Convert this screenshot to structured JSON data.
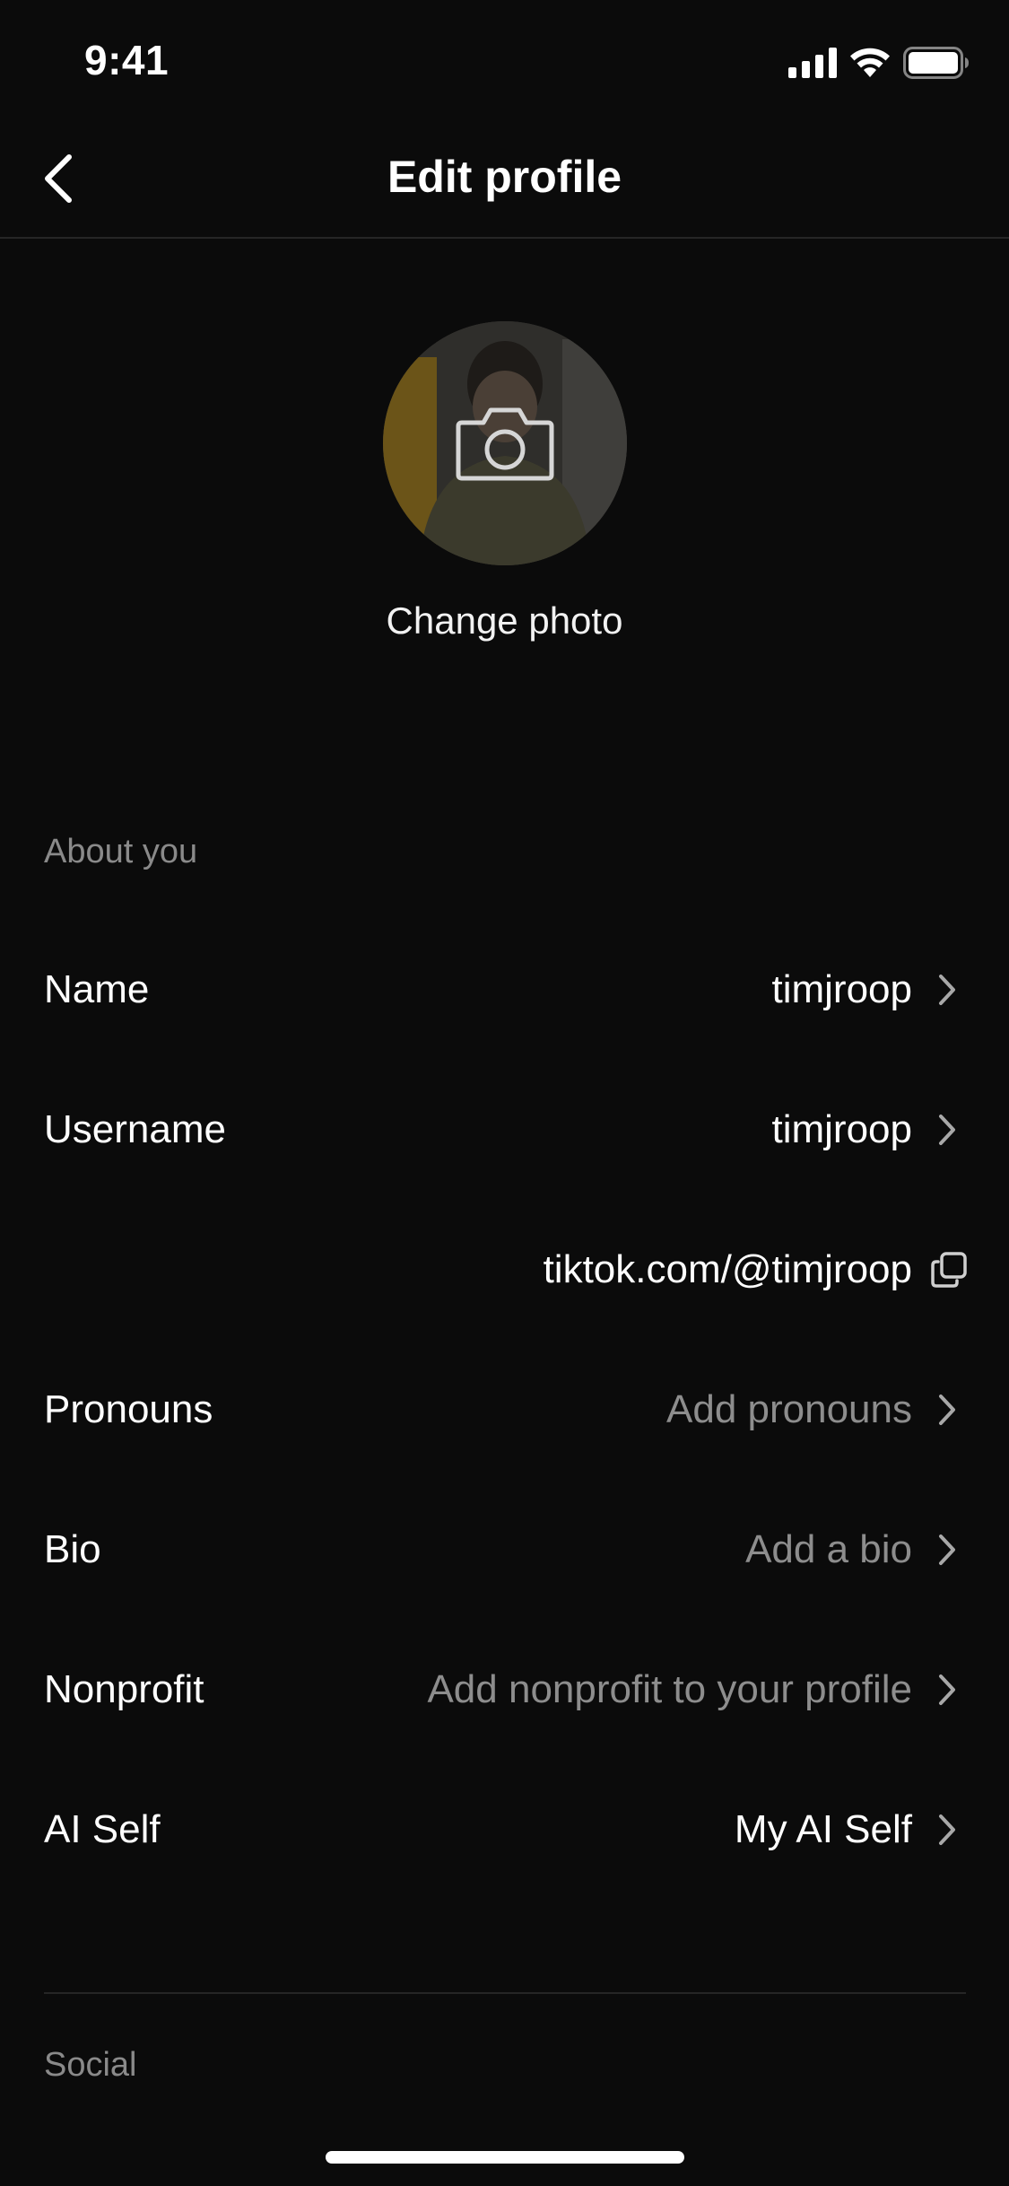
{
  "status_bar": {
    "time": "9:41"
  },
  "header": {
    "title": "Edit profile"
  },
  "profile_photo": {
    "change_label": "Change photo"
  },
  "about_section": {
    "label": "About you",
    "rows": [
      {
        "label": "Name",
        "value": "timjroop",
        "is_placeholder": false
      },
      {
        "label": "Username",
        "value": "timjroop",
        "is_placeholder": false
      },
      {
        "label": "",
        "value": "tiktok.com/@timjroop",
        "is_placeholder": false
      },
      {
        "label": "Pronouns",
        "value": "Add pronouns",
        "is_placeholder": true
      },
      {
        "label": "Bio",
        "value": "Add a bio",
        "is_placeholder": true
      },
      {
        "label": "Nonprofit",
        "value": "Add nonprofit to your profile",
        "is_placeholder": true
      },
      {
        "label": "AI Self",
        "value": "My AI Self",
        "is_placeholder": false
      }
    ]
  },
  "social_section": {
    "label": "Social"
  },
  "colors": {
    "background": "#0b0b0b",
    "text_primary": "#ffffff",
    "text_secondary": "#8a8a8a",
    "divider": "#262626"
  },
  "icons": {
    "back": "chevron-left-icon",
    "camera": "camera-icon",
    "row_chevron": "chevron-right-icon",
    "copy": "copy-icon",
    "signal": "cellular-signal-icon",
    "wifi": "wifi-icon",
    "battery": "battery-icon"
  }
}
